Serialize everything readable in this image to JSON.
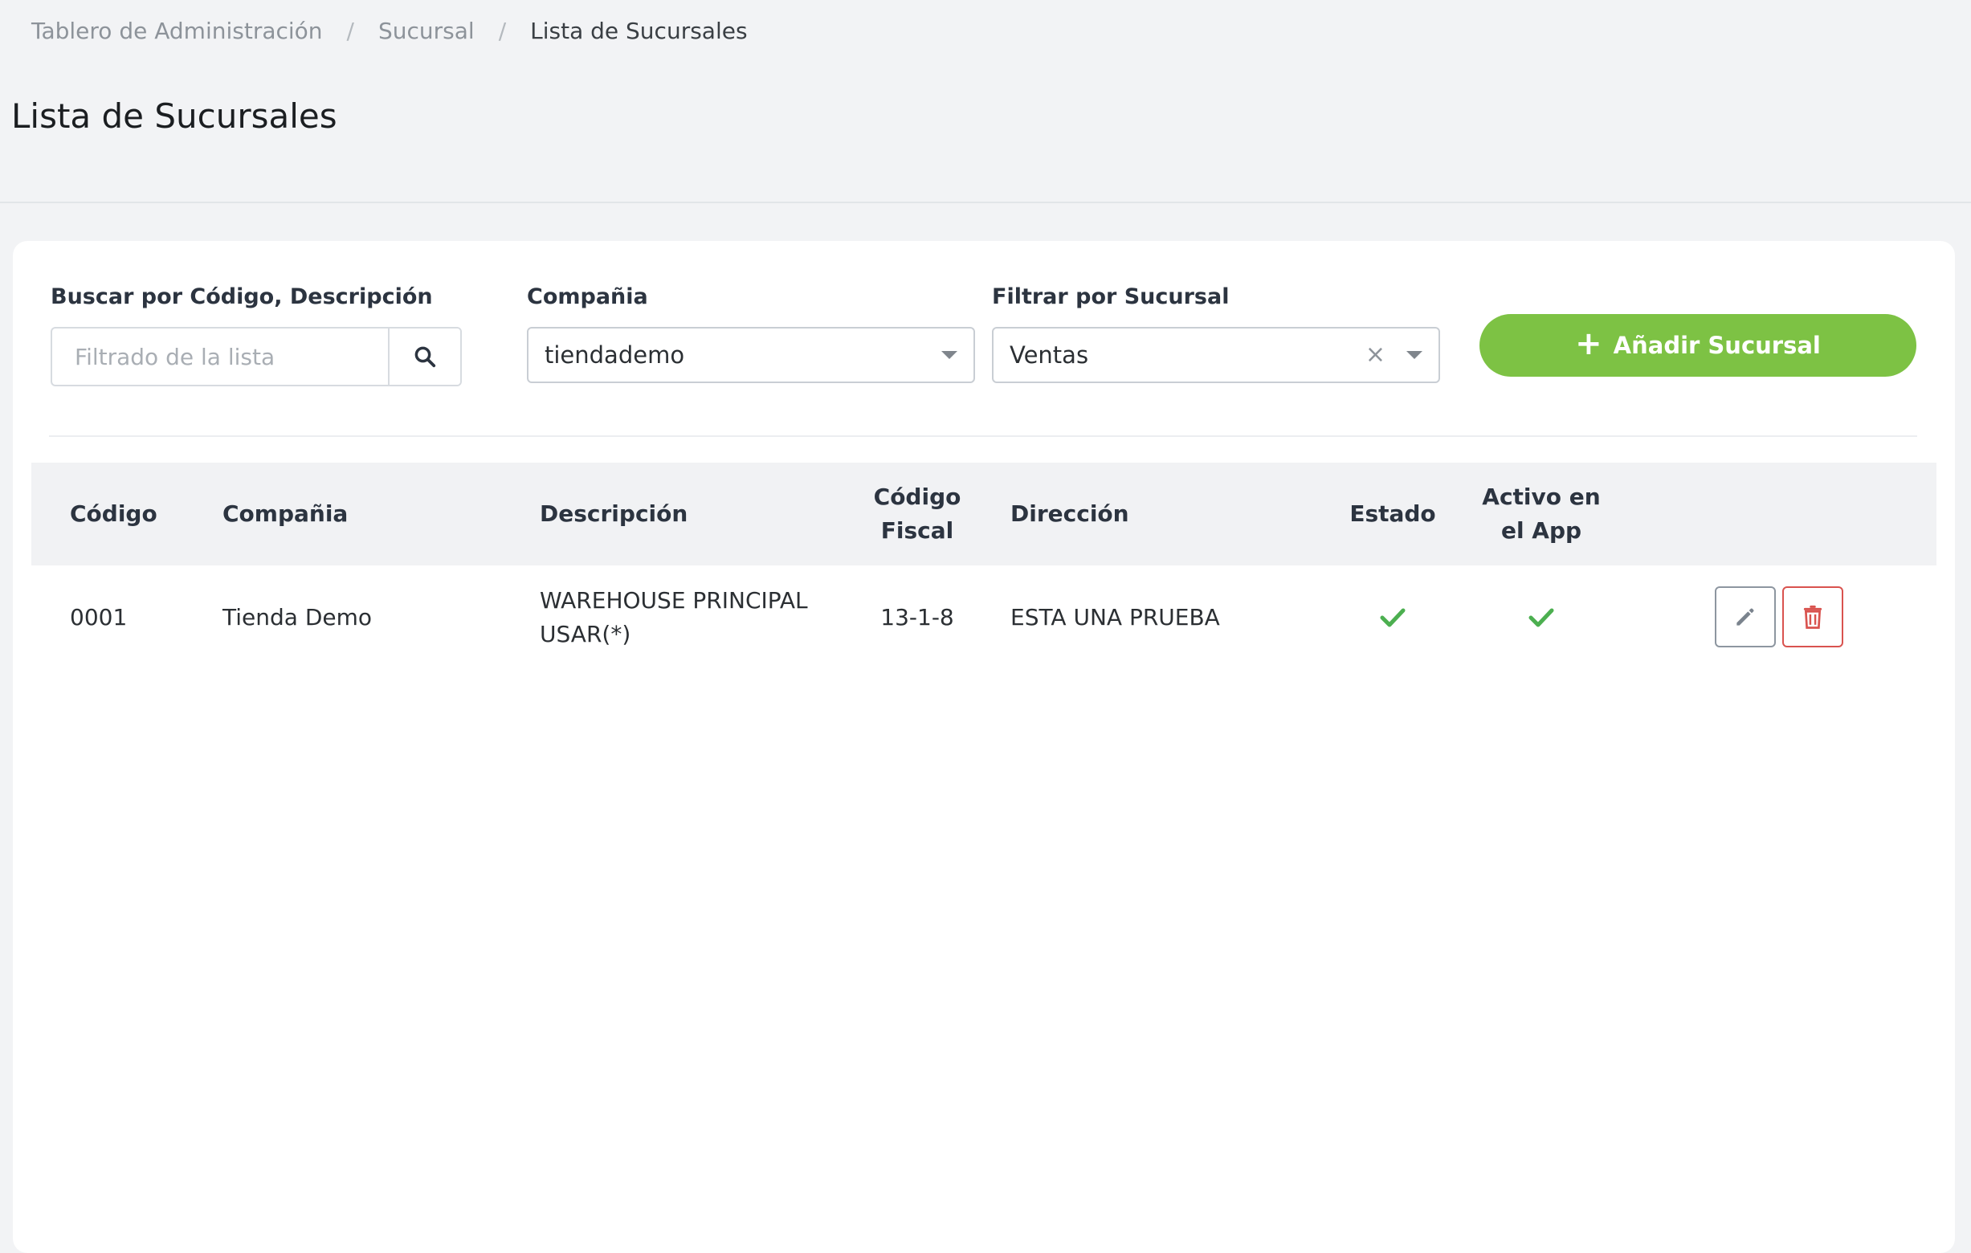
{
  "breadcrumb": {
    "items": [
      "Tablero de Administración",
      "Sucursal"
    ],
    "separator": "/",
    "current": "Lista de Sucursales"
  },
  "page": {
    "title": "Lista de Sucursales"
  },
  "filters": {
    "search": {
      "label": "Buscar por Código, Descripción",
      "placeholder": "Filtrado de la lista",
      "value": ""
    },
    "company": {
      "label": "Compañia",
      "selected": "tiendademo"
    },
    "branch": {
      "label": "Filtrar por Sucursal",
      "selected": "Ventas",
      "clear_glyph": "×"
    },
    "add_button": {
      "icon": "plus-icon",
      "label": "Añadir Sucursal"
    }
  },
  "table": {
    "headers": {
      "code": "Código",
      "company": "Compañia",
      "description": "Descripción",
      "fiscal_code": "Código Fiscal",
      "address": "Dirección",
      "status": "Estado",
      "active_app": "Activo en el App"
    },
    "rows": [
      {
        "code": "0001",
        "company": "Tienda Demo",
        "description": "WAREHOUSE PRINCIPAL USAR(*)",
        "fiscal_code": "13-1-8",
        "address": "ESTA UNA PRUEBA",
        "status": true,
        "active_app": true
      }
    ]
  },
  "colors": {
    "accent_green": "#7dc244",
    "check_green": "#4caf50",
    "danger_red": "#d9534f"
  }
}
